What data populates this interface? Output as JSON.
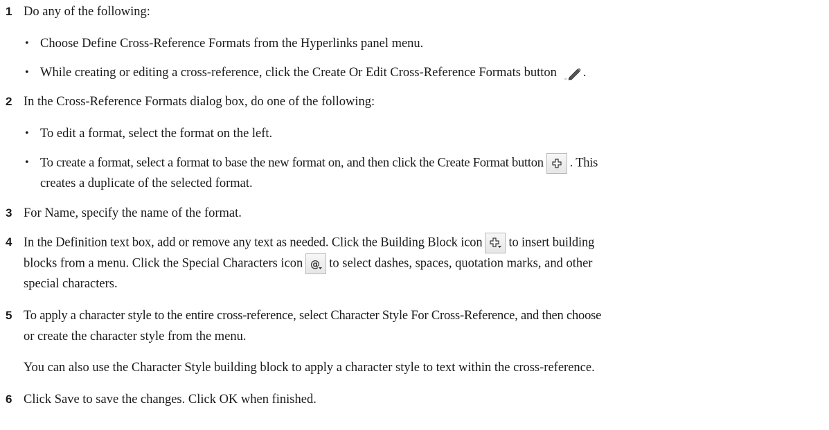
{
  "steps": [
    {
      "number": "1",
      "text": "Do any of the following:",
      "bullets": [
        "Choose Define Cross-Reference Formats from the Hyperlinks panel menu.",
        "While creating or editing a cross-reference, click the Create Or Edit Cross-Reference Formats button"
      ],
      "bullet2_suffix": "."
    },
    {
      "number": "2",
      "text": "In the Cross-Reference Formats dialog box, do one of the following:",
      "bullets": [
        "To edit a format, select the format on the left.",
        "To create a format, select a format to base the new format on, and then click the Create Format button"
      ],
      "bullet2_suffix": ". This",
      "bullet2_line2": "creates a duplicate of the selected format."
    },
    {
      "number": "3",
      "text": "For Name, specify the name of the format."
    },
    {
      "number": "4",
      "text_part1": "In the Definition text box, add or remove any text as needed. Click the Building Block icon",
      "text_part2": "to insert building",
      "text_line2_part1": "blocks from a menu. Click the Special Characters icon",
      "text_line2_part2": "to select dashes, spaces, quotation marks, and other",
      "text_line3": "special characters."
    },
    {
      "number": "5",
      "text_line1": "To apply a character style to the entire cross-reference, select Character Style For Cross-Reference, and then choose",
      "text_line2": "or create the character style from the menu.",
      "note": "You can also use the Character Style building block to apply a character style to text within the cross-reference."
    },
    {
      "number": "6",
      "text": "Click Save to save the changes. Click OK when finished."
    }
  ],
  "icons": {
    "edit_formats": "pencil-icon",
    "create_format": "plus-icon",
    "building_block": "plus-menu-icon",
    "special_characters": "at-menu-icon"
  }
}
